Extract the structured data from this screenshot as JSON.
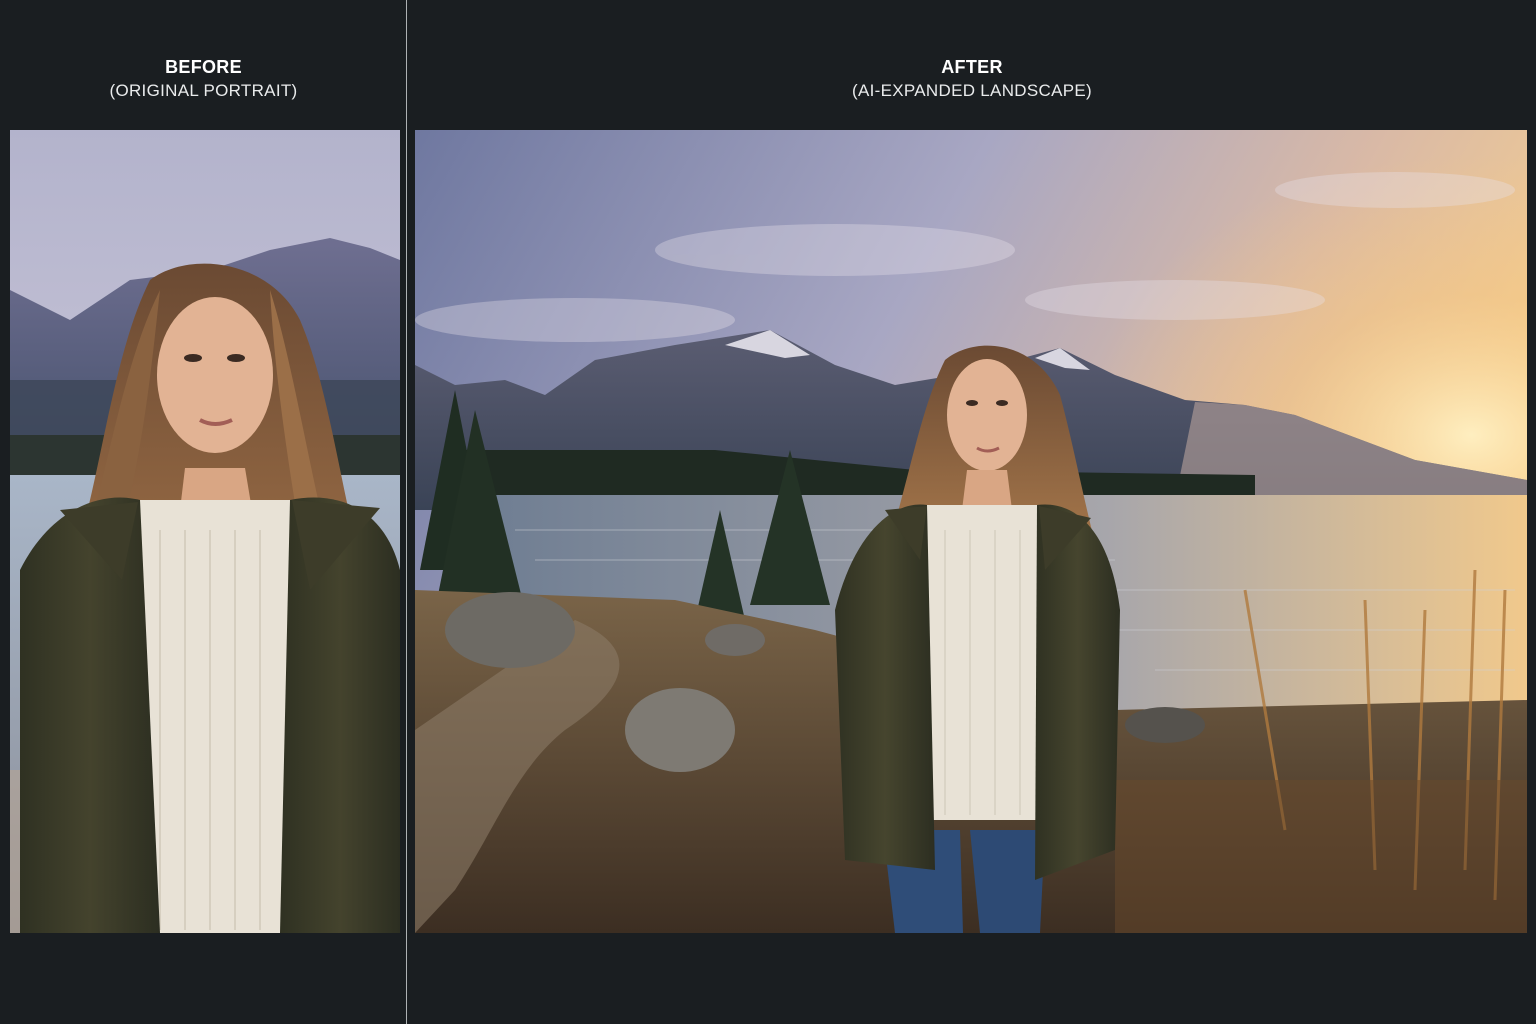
{
  "before": {
    "title": "BEFORE",
    "subtitle": "(ORIGINAL PORTRAIT)"
  },
  "after": {
    "title": "AFTER",
    "subtitle": "(AI-EXPANDED LANDSCAPE)"
  },
  "colors": {
    "background": "#1a1e21",
    "divider": "#c9ccce",
    "sky_blue": "#8c93b5",
    "sunset_gold": "#f2c98a",
    "jacket_olive": "#3e3d2a",
    "sweater_cream": "#e8e2d6"
  }
}
